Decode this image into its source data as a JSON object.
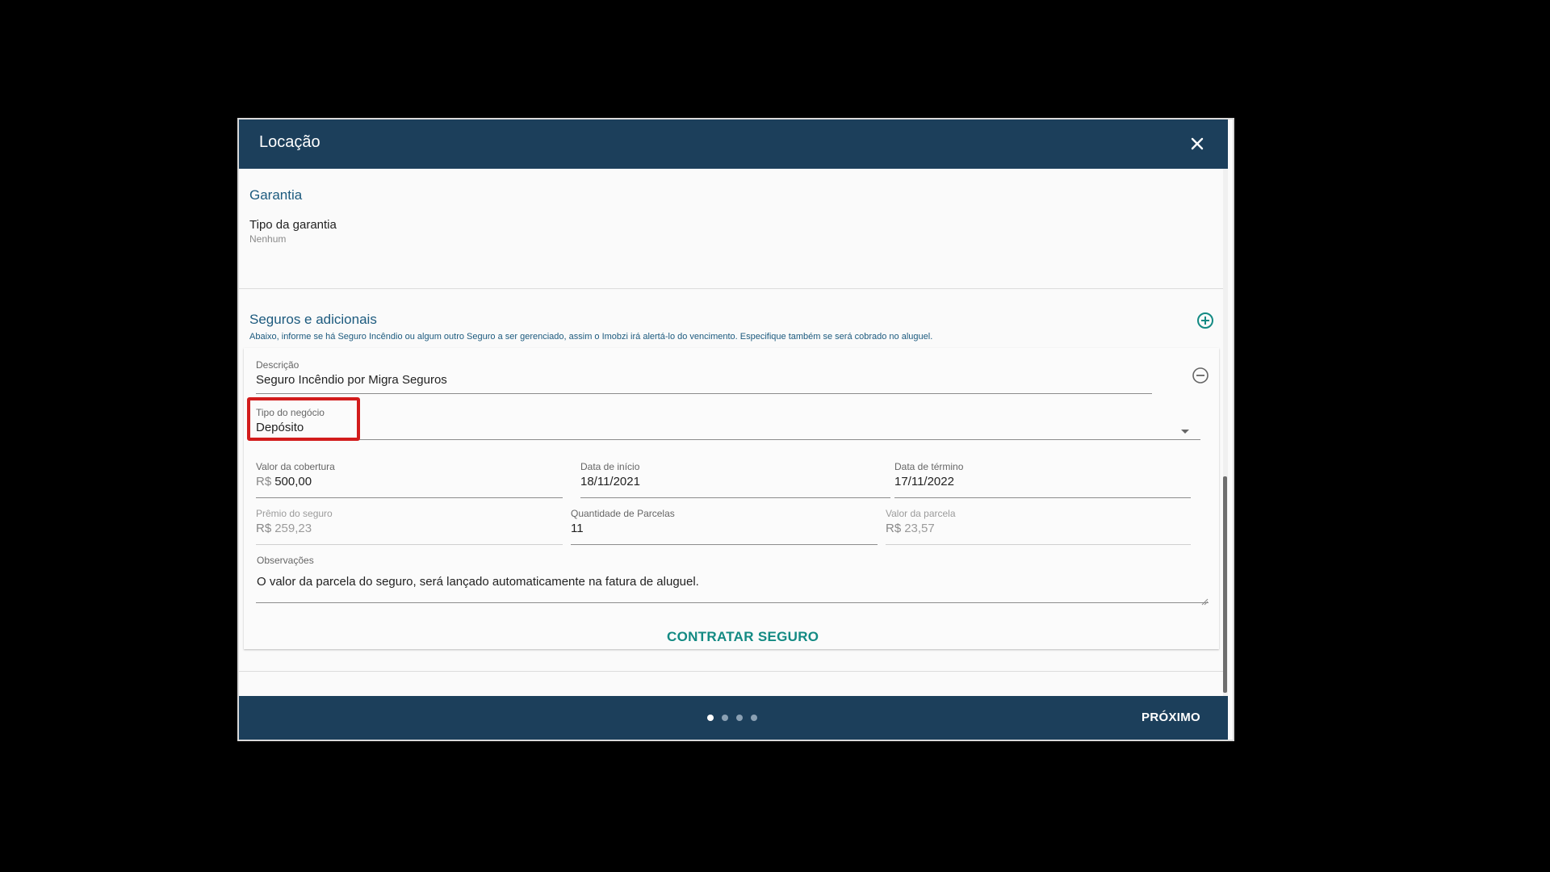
{
  "dialog": {
    "title": "Locação",
    "icons": {
      "close": "close-icon",
      "add": "plus-circle-icon",
      "remove": "minus-circle-icon",
      "dropdown": "chevron-down-icon"
    },
    "colors": {
      "header": "#1c3f5b",
      "accent": "#138a83",
      "highlight": "#d21c1c"
    }
  },
  "garantia": {
    "title": "Garantia",
    "tipo_label": "Tipo da garantia",
    "tipo_value": "Nenhum"
  },
  "seguros": {
    "title": "Seguros e adicionais",
    "subtitle": "Abaixo, informe se há Seguro Incêndio ou algum outro Seguro a ser gerenciado, assim o Imobzi irá alertá-lo do vencimento. Especifique também se será cobrado no aluguel.",
    "descricao_label": "Descrição",
    "descricao_value": "Seguro Incêndio por Migra Seguros",
    "tipo_negocio_label": "Tipo do negócio",
    "tipo_negocio_value": "Depósito",
    "valor_cobertura_label": "Valor da cobertura",
    "valor_cobertura_prefix": "R$",
    "valor_cobertura_value": "500,00",
    "data_inicio_label": "Data de início",
    "data_inicio_value": "18/11/2021",
    "data_termino_label": "Data de término",
    "data_termino_value": "17/11/2022",
    "premio_label": "Prêmio do seguro",
    "premio_prefix": "R$",
    "premio_value": "259,23",
    "parcelas_label": "Quantidade de Parcelas",
    "parcelas_value": "11",
    "valor_parcela_label": "Valor da parcela",
    "valor_parcela_prefix": "R$",
    "valor_parcela_value": "23,57",
    "observacoes_label": "Observações",
    "observacoes_value": "O valor da parcela do seguro, será lançado automaticamente na fatura de aluguel.",
    "contratar_label": "CONTRATAR SEGURO"
  },
  "footer": {
    "next_label": "PRÓXIMO",
    "steps_total": 4,
    "step_current": 1
  }
}
